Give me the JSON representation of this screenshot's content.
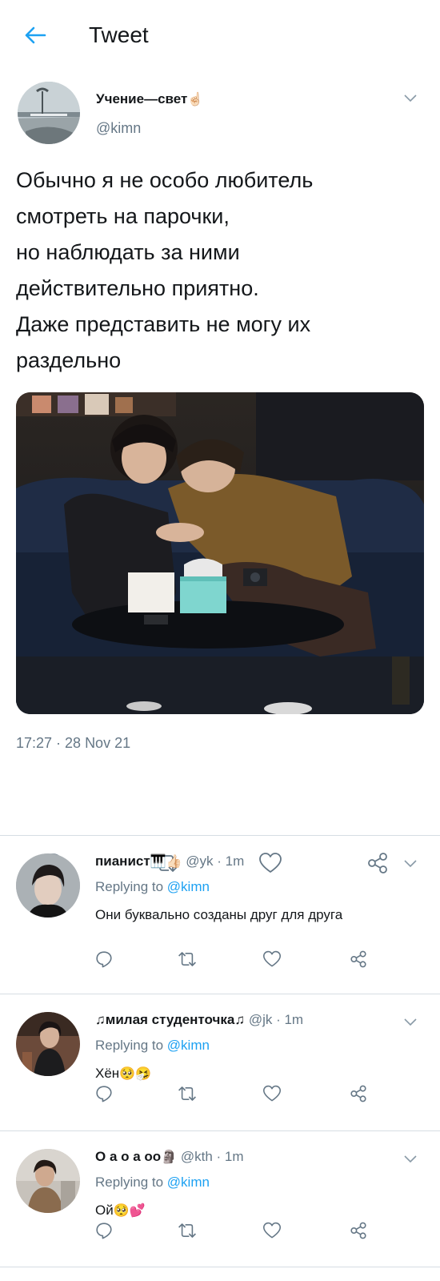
{
  "header": {
    "title": "Tweet",
    "back_icon": "arrow-left-icon",
    "accent": "#1da1f2"
  },
  "tweet": {
    "author_name": "Учение—свет",
    "author_emoji": "☝🏻",
    "handle": "@kimn",
    "text_lines": [
      "Обычно я не особо любитель",
      "смотреть на парочки,",
      "но наблюдать за ними",
      "действительно приятно.",
      "Даже представить не могу их",
      "раздельно"
    ],
    "timestamp": "17:27 · 28 Nov 21",
    "actions": [
      "reply-icon",
      "retweet-icon",
      "like-icon",
      "share-icon"
    ]
  },
  "replies": [
    {
      "name": "пианист",
      "name_emoji": "🎹👍🏻",
      "handle": "@yk",
      "time": "· 1m",
      "replying_prefix": "Replying to ",
      "replying_to": "@kimn",
      "text": "Они буквально созданы друг для друга"
    },
    {
      "name": "♫милая студенточка♫",
      "name_emoji": "",
      "handle": "@jk",
      "time": "· 1m",
      "replying_prefix": "Replying to ",
      "replying_to": "@kimn",
      "text": "Хён",
      "text_emoji": "🥺🤧"
    },
    {
      "name": "О а о а оо",
      "name_emoji": "🗿",
      "handle": "@kth",
      "time": "· 1m",
      "replying_prefix": "Replying to ",
      "replying_to": "@kimn",
      "text": "Ой",
      "text_emoji": "🥺💕"
    }
  ]
}
